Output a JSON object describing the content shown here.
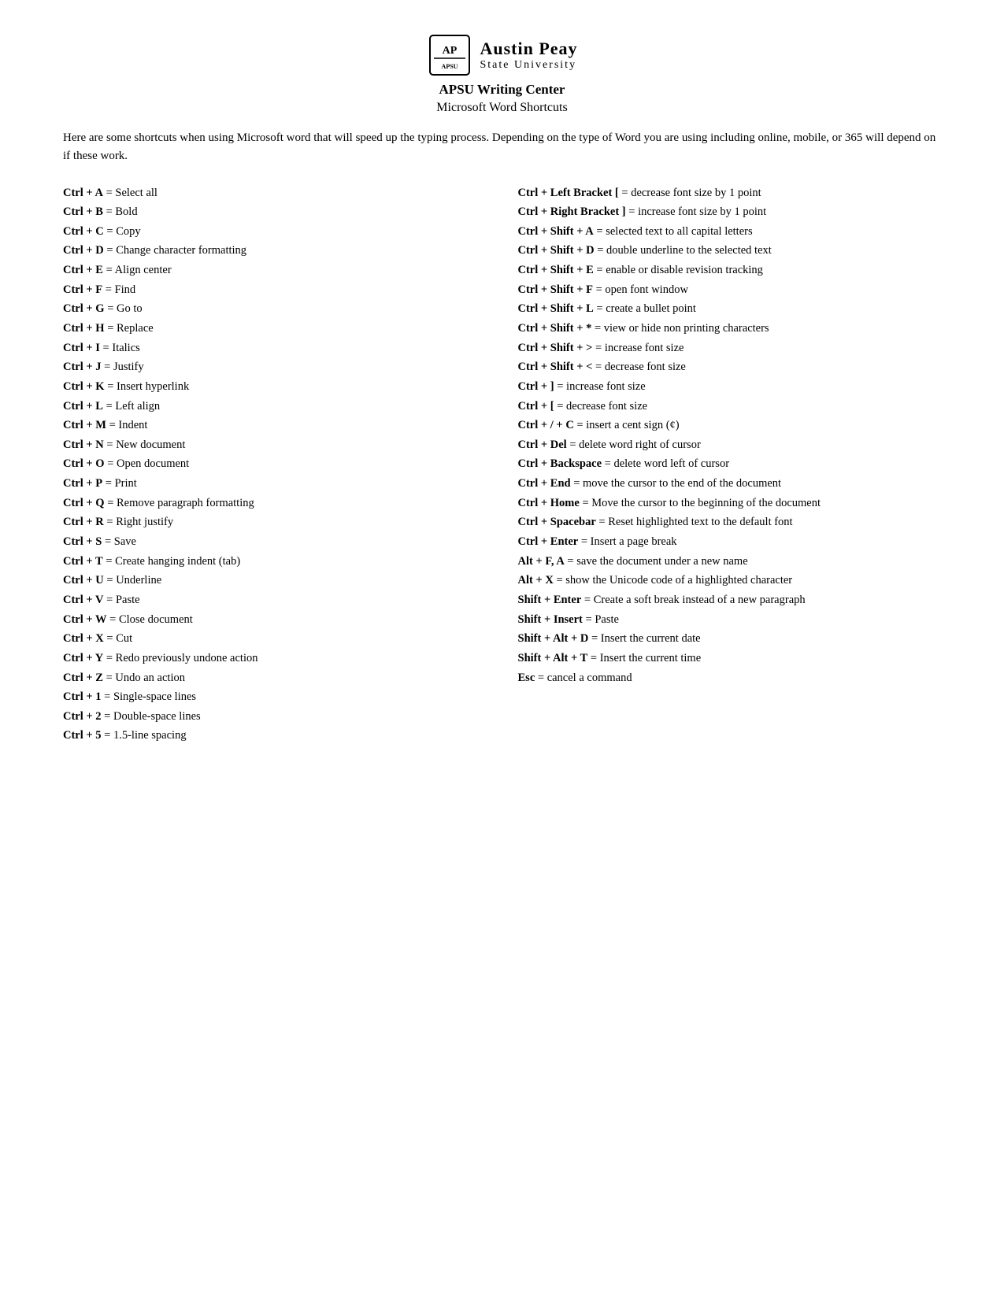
{
  "header": {
    "logo_line1": "Austin Peay",
    "logo_line2": "State University",
    "center_title": "APSU Writing Center",
    "subtitle": "Microsoft Word Shortcuts"
  },
  "intro": "Here are some shortcuts when using Microsoft word that will speed up the typing process. Depending on the type of Word you are using including online, mobile, or 365 will depend on if these work.",
  "left_shortcuts": [
    {
      "key": "Ctrl + A",
      "eq": " = ",
      "desc": "Select all"
    },
    {
      "key": "Ctrl + B",
      "eq": " = ",
      "desc": "Bold"
    },
    {
      "key": "Ctrl + C",
      "eq": " = ",
      "desc": "Copy"
    },
    {
      "key": "Ctrl + D",
      "eq": " = ",
      "desc": "Change character formatting"
    },
    {
      "key": "Ctrl + E",
      "eq": " = ",
      "desc": "Align center"
    },
    {
      "key": "Ctrl + F",
      "eq": " = ",
      "desc": "Find"
    },
    {
      "key": "Ctrl + G",
      "eq": " = ",
      "desc": "Go to"
    },
    {
      "key": "Ctrl + H",
      "eq": " = ",
      "desc": "Replace"
    },
    {
      "key": "Ctrl + I",
      "eq": " = ",
      "desc": "Italics"
    },
    {
      "key": "Ctrl + J",
      "eq": " = ",
      "desc": "Justify"
    },
    {
      "key": "Ctrl + K",
      "eq": " = ",
      "desc": "Insert hyperlink"
    },
    {
      "key": "Ctrl + L",
      "eq": " = ",
      "desc": "Left align"
    },
    {
      "key": "Ctrl + M",
      "eq": " = ",
      "desc": "Indent"
    },
    {
      "key": "Ctrl + N",
      "eq": " = ",
      "desc": "New document"
    },
    {
      "key": "Ctrl + O",
      "eq": " = ",
      "desc": "Open document"
    },
    {
      "key": "Ctrl + P",
      "eq": " = ",
      "desc": "Print"
    },
    {
      "key": "Ctrl + Q",
      "eq": " = ",
      "desc": "Remove paragraph formatting"
    },
    {
      "key": "Ctrl + R",
      "eq": " = ",
      "desc": "Right justify"
    },
    {
      "key": "Ctrl + S",
      "eq": " = ",
      "desc": "Save"
    },
    {
      "key": "Ctrl + T",
      "eq": " = ",
      "desc": "Create hanging indent (tab)"
    },
    {
      "key": "Ctrl + U",
      "eq": " = ",
      "desc": "Underline"
    },
    {
      "key": "Ctrl + V",
      "eq": " = ",
      "desc": "Paste"
    },
    {
      "key": "Ctrl + W",
      "eq": " = ",
      "desc": "Close document"
    },
    {
      "key": "Ctrl + X",
      "eq": " = ",
      "desc": "Cut"
    },
    {
      "key": "Ctrl + Y",
      "eq": " = ",
      "desc": "Redo previously undone action"
    },
    {
      "key": "Ctrl + Z",
      "eq": " = ",
      "desc": "Undo an action"
    },
    {
      "key": "Ctrl + 1",
      "eq": " = ",
      "desc": "Single-space lines"
    },
    {
      "key": "Ctrl + 2",
      "eq": " = ",
      "desc": "Double-space lines"
    },
    {
      "key": "Ctrl + 5",
      "eq": " = ",
      "desc": "1.5-line spacing"
    }
  ],
  "right_shortcuts": [
    {
      "key": "Ctrl + Left Bracket [",
      "eq": " = ",
      "desc": "decrease font size by 1 point"
    },
    {
      "key": "Ctrl + Right Bracket ]",
      "eq": " = ",
      "desc": "increase font size by 1 point"
    },
    {
      "key": "Ctrl + Shift + A",
      "eq": " =  ",
      "desc": "selected text to all capital letters"
    },
    {
      "key": "Ctrl + Shift + D",
      "eq": " =  ",
      "desc": "double underline to the selected text"
    },
    {
      "key": "Ctrl + Shift + E",
      "eq": " = ",
      "desc": "enable or disable revision tracking"
    },
    {
      "key": "Ctrl + Shift + F",
      "eq": " = ",
      "desc": "open font window"
    },
    {
      "key": "Ctrl + Shift + L",
      "eq": " = ",
      "desc": "create a bullet point"
    },
    {
      "key": "Ctrl + Shift + *",
      "eq": " = ",
      "desc": "view or hide non printing characters"
    },
    {
      "key": "Ctrl + Shift + >",
      "eq": " = ",
      "desc": "increase font size"
    },
    {
      "key": "Ctrl + Shift + <",
      "eq": " = ",
      "desc": "decrease font size"
    },
    {
      "key": "Ctrl + ]",
      "eq": " = ",
      "desc": "increase font size"
    },
    {
      "key": "Ctrl + [",
      "eq": " = ",
      "desc": "decrease font size"
    },
    {
      "key": "Ctrl + / + C",
      "eq": " = ",
      "desc": "insert a cent sign (¢)"
    },
    {
      "key": "Ctrl + Del",
      "eq": " = ",
      "desc": "delete word right of cursor"
    },
    {
      "key": "Ctrl + Backspace",
      "eq": " = ",
      "desc": "delete word left of cursor"
    },
    {
      "key": "Ctrl + End",
      "eq": " = ",
      "desc": "move the cursor to the end of the document"
    },
    {
      "key": "Ctrl + Home",
      "eq": " = ",
      "desc": "Move the cursor to the beginning of the document"
    },
    {
      "key": "Ctrl + Spacebar",
      "eq": " = ",
      "desc": "Reset highlighted text to the default font"
    },
    {
      "key": "Ctrl + Enter",
      "eq": " = ",
      "desc": "Insert a page break"
    },
    {
      "key": "Alt + F, A",
      "eq": " = ",
      "desc": "save the document under a new name"
    },
    {
      "key": "Alt + X",
      "eq": " = ",
      "desc": "show the Unicode code of a highlighted character"
    },
    {
      "key": "Shift + Enter",
      "eq": " = ",
      "desc": "Create a soft break instead of a new paragraph"
    },
    {
      "key": "Shift + Insert",
      "eq": " = ",
      "desc": "Paste"
    },
    {
      "key": "Shift + Alt + D",
      "eq": " = ",
      "desc": "Insert the current date"
    },
    {
      "key": "Shift + Alt + T",
      "eq": " = ",
      "desc": "Insert the current time"
    },
    {
      "key": "Esc",
      "eq": " = ",
      "desc": "cancel a command"
    }
  ]
}
